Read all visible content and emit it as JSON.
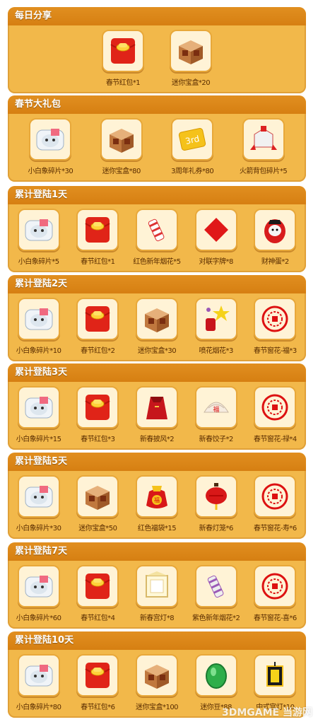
{
  "sections": [
    {
      "title": "每日分享",
      "items": [
        {
          "icon": "red-envelope-icon",
          "label": "春节红包*1"
        },
        {
          "icon": "treasure-box-icon",
          "label": "迷你宝盒*20"
        }
      ]
    },
    {
      "title": "春节大礼包",
      "items": [
        {
          "icon": "elephant-shard-icon",
          "label": "小白象碎片*30"
        },
        {
          "icon": "treasure-box-icon",
          "label": "迷你宝盒*80"
        },
        {
          "icon": "anniversary-coupon-icon",
          "label": "3周年礼券*80"
        },
        {
          "icon": "rocket-backpack-shard-icon",
          "label": "火箭背包碎片*5"
        }
      ]
    },
    {
      "title": "累计登陆1天",
      "items": [
        {
          "icon": "elephant-shard-icon",
          "label": "小白象碎片*5"
        },
        {
          "icon": "red-envelope-icon",
          "label": "春节红包*1"
        },
        {
          "icon": "firework-icon",
          "label": "红色新年烟花*5"
        },
        {
          "icon": "couplet-icon",
          "label": "对联字牌*8"
        },
        {
          "icon": "fortune-egg-icon",
          "label": "财神蛋*2"
        }
      ]
    },
    {
      "title": "累计登陆2天",
      "items": [
        {
          "icon": "elephant-shard-icon",
          "label": "小白象碎片*10"
        },
        {
          "icon": "red-envelope-icon",
          "label": "春节红包*2"
        },
        {
          "icon": "treasure-box-icon",
          "label": "迷你宝盒*30"
        },
        {
          "icon": "sparkler-firework-icon",
          "label": "喷花烟花*3"
        },
        {
          "icon": "paper-cut-icon",
          "label": "春节窗花-福*3"
        }
      ]
    },
    {
      "title": "累计登陆3天",
      "items": [
        {
          "icon": "elephant-shard-icon",
          "label": "小白象碎片*15"
        },
        {
          "icon": "red-envelope-icon",
          "label": "春节红包*3"
        },
        {
          "icon": "cape-icon",
          "label": "新春披风*2"
        },
        {
          "icon": "dumpling-icon",
          "label": "新春饺子*2"
        },
        {
          "icon": "paper-cut-icon",
          "label": "春节窗花-禄*4"
        }
      ]
    },
    {
      "title": "累计登陆5天",
      "items": [
        {
          "icon": "elephant-shard-icon",
          "label": "小白象碎片*30"
        },
        {
          "icon": "treasure-box-icon",
          "label": "迷你宝盒*50"
        },
        {
          "icon": "lucky-bag-icon",
          "label": "红色福袋*15"
        },
        {
          "icon": "lantern-icon",
          "label": "新春灯笼*6"
        },
        {
          "icon": "paper-cut-icon",
          "label": "春节窗花-寿*6"
        }
      ]
    },
    {
      "title": "累计登陆7天",
      "items": [
        {
          "icon": "elephant-shard-icon",
          "label": "小白象碎片*60"
        },
        {
          "icon": "red-envelope-icon",
          "label": "春节红包*4"
        },
        {
          "icon": "palace-lamp-icon",
          "label": "新春宫灯*8"
        },
        {
          "icon": "purple-firework-icon",
          "label": "紫色新年烟花*2"
        },
        {
          "icon": "paper-cut-icon",
          "label": "春节窗花-喜*6"
        }
      ]
    },
    {
      "title": "累计登陆10天",
      "items": [
        {
          "icon": "elephant-shard-icon",
          "label": "小白象碎片*80"
        },
        {
          "icon": "red-envelope-icon",
          "label": "春节红包*6"
        },
        {
          "icon": "treasure-box-icon",
          "label": "迷你宝盒*100"
        },
        {
          "icon": "mini-bean-icon",
          "label": "迷你豆*88"
        },
        {
          "icon": "chinese-lamp-icon",
          "label": "中式宫灯*10"
        }
      ]
    }
  ],
  "watermark": "3DMGAME 当游网",
  "colors": {
    "panel": "#f2b84a",
    "header": "#d67f12",
    "label": "#5a2d00"
  }
}
